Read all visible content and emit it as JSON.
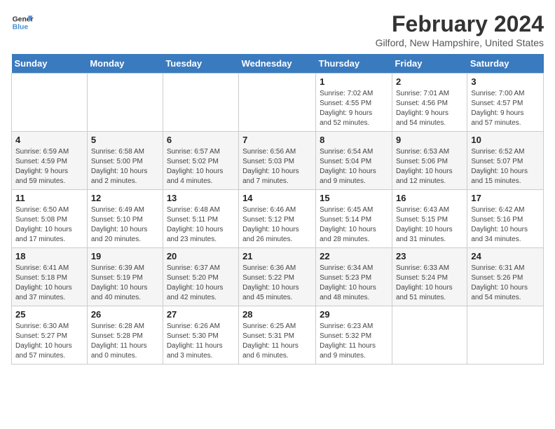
{
  "logo": {
    "line1": "General",
    "line2": "Blue"
  },
  "title": "February 2024",
  "subtitle": "Gilford, New Hampshire, United States",
  "days_of_week": [
    "Sunday",
    "Monday",
    "Tuesday",
    "Wednesday",
    "Thursday",
    "Friday",
    "Saturday"
  ],
  "weeks": [
    [
      {
        "day": "",
        "info": ""
      },
      {
        "day": "",
        "info": ""
      },
      {
        "day": "",
        "info": ""
      },
      {
        "day": "",
        "info": ""
      },
      {
        "day": "1",
        "info": "Sunrise: 7:02 AM\nSunset: 4:55 PM\nDaylight: 9 hours\nand 52 minutes."
      },
      {
        "day": "2",
        "info": "Sunrise: 7:01 AM\nSunset: 4:56 PM\nDaylight: 9 hours\nand 54 minutes."
      },
      {
        "day": "3",
        "info": "Sunrise: 7:00 AM\nSunset: 4:57 PM\nDaylight: 9 hours\nand 57 minutes."
      }
    ],
    [
      {
        "day": "4",
        "info": "Sunrise: 6:59 AM\nSunset: 4:59 PM\nDaylight: 9 hours\nand 59 minutes."
      },
      {
        "day": "5",
        "info": "Sunrise: 6:58 AM\nSunset: 5:00 PM\nDaylight: 10 hours\nand 2 minutes."
      },
      {
        "day": "6",
        "info": "Sunrise: 6:57 AM\nSunset: 5:02 PM\nDaylight: 10 hours\nand 4 minutes."
      },
      {
        "day": "7",
        "info": "Sunrise: 6:56 AM\nSunset: 5:03 PM\nDaylight: 10 hours\nand 7 minutes."
      },
      {
        "day": "8",
        "info": "Sunrise: 6:54 AM\nSunset: 5:04 PM\nDaylight: 10 hours\nand 9 minutes."
      },
      {
        "day": "9",
        "info": "Sunrise: 6:53 AM\nSunset: 5:06 PM\nDaylight: 10 hours\nand 12 minutes."
      },
      {
        "day": "10",
        "info": "Sunrise: 6:52 AM\nSunset: 5:07 PM\nDaylight: 10 hours\nand 15 minutes."
      }
    ],
    [
      {
        "day": "11",
        "info": "Sunrise: 6:50 AM\nSunset: 5:08 PM\nDaylight: 10 hours\nand 17 minutes."
      },
      {
        "day": "12",
        "info": "Sunrise: 6:49 AM\nSunset: 5:10 PM\nDaylight: 10 hours\nand 20 minutes."
      },
      {
        "day": "13",
        "info": "Sunrise: 6:48 AM\nSunset: 5:11 PM\nDaylight: 10 hours\nand 23 minutes."
      },
      {
        "day": "14",
        "info": "Sunrise: 6:46 AM\nSunset: 5:12 PM\nDaylight: 10 hours\nand 26 minutes."
      },
      {
        "day": "15",
        "info": "Sunrise: 6:45 AM\nSunset: 5:14 PM\nDaylight: 10 hours\nand 28 minutes."
      },
      {
        "day": "16",
        "info": "Sunrise: 6:43 AM\nSunset: 5:15 PM\nDaylight: 10 hours\nand 31 minutes."
      },
      {
        "day": "17",
        "info": "Sunrise: 6:42 AM\nSunset: 5:16 PM\nDaylight: 10 hours\nand 34 minutes."
      }
    ],
    [
      {
        "day": "18",
        "info": "Sunrise: 6:41 AM\nSunset: 5:18 PM\nDaylight: 10 hours\nand 37 minutes."
      },
      {
        "day": "19",
        "info": "Sunrise: 6:39 AM\nSunset: 5:19 PM\nDaylight: 10 hours\nand 40 minutes."
      },
      {
        "day": "20",
        "info": "Sunrise: 6:37 AM\nSunset: 5:20 PM\nDaylight: 10 hours\nand 42 minutes."
      },
      {
        "day": "21",
        "info": "Sunrise: 6:36 AM\nSunset: 5:22 PM\nDaylight: 10 hours\nand 45 minutes."
      },
      {
        "day": "22",
        "info": "Sunrise: 6:34 AM\nSunset: 5:23 PM\nDaylight: 10 hours\nand 48 minutes."
      },
      {
        "day": "23",
        "info": "Sunrise: 6:33 AM\nSunset: 5:24 PM\nDaylight: 10 hours\nand 51 minutes."
      },
      {
        "day": "24",
        "info": "Sunrise: 6:31 AM\nSunset: 5:26 PM\nDaylight: 10 hours\nand 54 minutes."
      }
    ],
    [
      {
        "day": "25",
        "info": "Sunrise: 6:30 AM\nSunset: 5:27 PM\nDaylight: 10 hours\nand 57 minutes."
      },
      {
        "day": "26",
        "info": "Sunrise: 6:28 AM\nSunset: 5:28 PM\nDaylight: 11 hours\nand 0 minutes."
      },
      {
        "day": "27",
        "info": "Sunrise: 6:26 AM\nSunset: 5:30 PM\nDaylight: 11 hours\nand 3 minutes."
      },
      {
        "day": "28",
        "info": "Sunrise: 6:25 AM\nSunset: 5:31 PM\nDaylight: 11 hours\nand 6 minutes."
      },
      {
        "day": "29",
        "info": "Sunrise: 6:23 AM\nSunset: 5:32 PM\nDaylight: 11 hours\nand 9 minutes."
      },
      {
        "day": "",
        "info": ""
      },
      {
        "day": "",
        "info": ""
      }
    ]
  ]
}
